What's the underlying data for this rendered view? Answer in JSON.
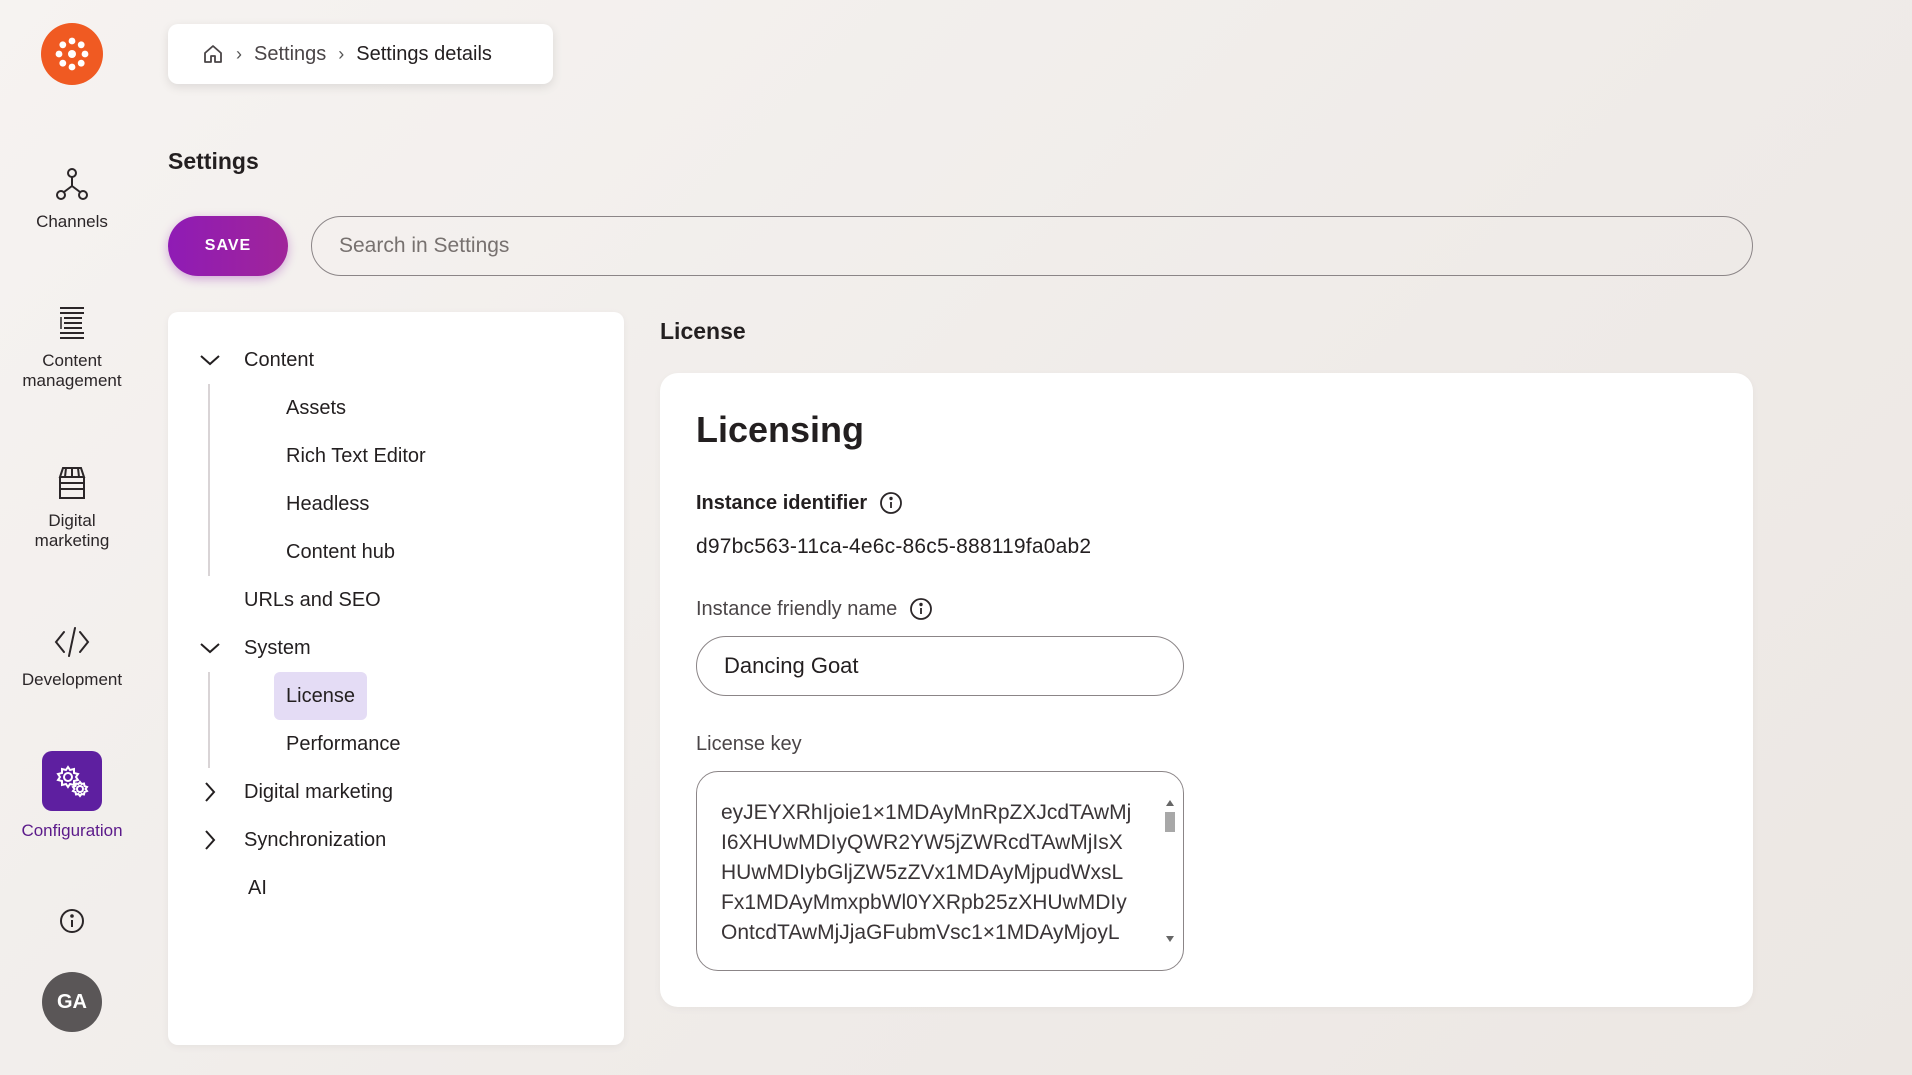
{
  "rail": {
    "logo": "kentico-logo",
    "items": [
      {
        "label": "Channels",
        "icon": "channels-icon"
      },
      {
        "label": "Content\nmanagement",
        "icon": "content-management-icon"
      },
      {
        "label": "Digital\nmarketing",
        "icon": "digital-marketing-icon"
      },
      {
        "label": "Development",
        "icon": "development-icon"
      },
      {
        "label": "Configuration",
        "icon": "configuration-icon"
      }
    ],
    "avatar": "GA"
  },
  "breadcrumb": {
    "items": [
      "Settings",
      "Settings details"
    ]
  },
  "page": {
    "title": "Settings",
    "save_label": "SAVE",
    "search_placeholder": "Search in Settings"
  },
  "tree": {
    "items": [
      {
        "label": "Content"
      },
      {
        "label": "Assets"
      },
      {
        "label": "Rich Text Editor"
      },
      {
        "label": "Headless"
      },
      {
        "label": "Content hub"
      },
      {
        "label": "URLs and SEO"
      },
      {
        "label": "System"
      },
      {
        "label": "License"
      },
      {
        "label": "Performance"
      },
      {
        "label": "Digital marketing"
      },
      {
        "label": "Synchronization"
      },
      {
        "label": "AI"
      }
    ]
  },
  "section": {
    "title": "License",
    "card_title": "Licensing",
    "instance_identifier_label": "Instance identifier",
    "instance_identifier_value": "d97bc563-11ca-4e6c-86c5-888119fa0ab2",
    "friendly_name_label": "Instance friendly name",
    "friendly_name_value": "Dancing Goat",
    "license_key_label": "License key",
    "license_key_value": "eyJEYXRhIjoie1×1MDAyMnRpZXJcdTAwMj\nI6XHUwMDIyQWR2YW5jZWRcdTAwMjIsX\nHUwMDIybGljZW5zZVx1MDAyMjpudWxsL\nFx1MDAyMmxpbWl0YXRpb25zXHUwMDIy\nOntcdTAwMjJjaGFubmVsc1×1MDAyMjoyL"
  },
  "colors": {
    "brand_orange": "#f05a22",
    "accent_purple": "#5e1fa0",
    "save_gradient_start": "#8f1bb5",
    "selected_bg": "#e4dcf5"
  }
}
